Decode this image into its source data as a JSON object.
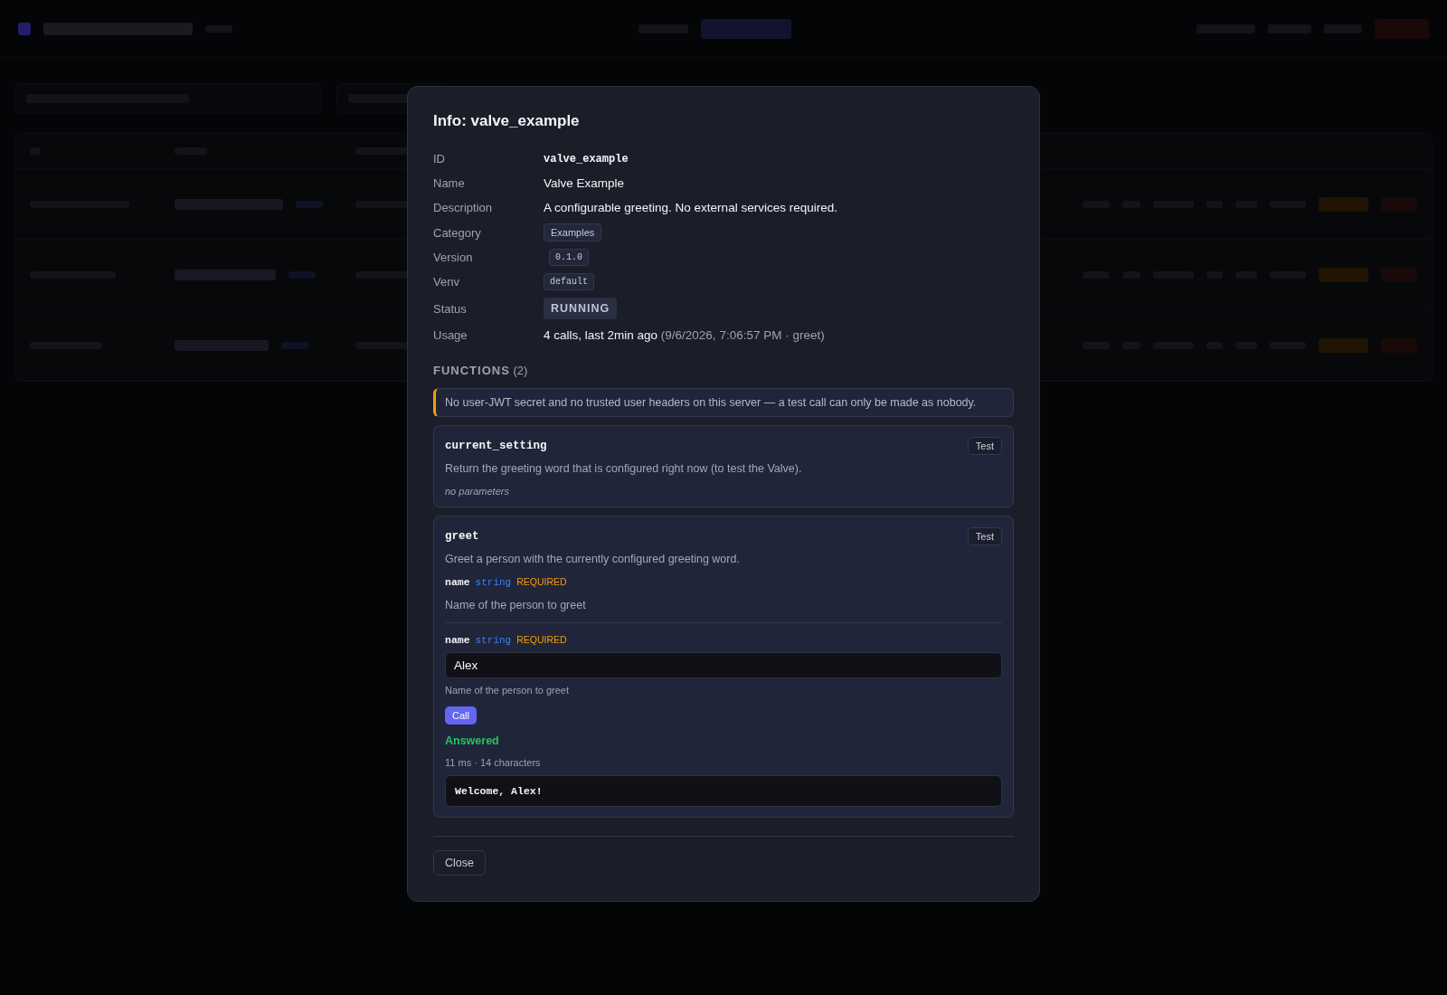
{
  "dialog": {
    "title": "Info: valve_example",
    "fields": [
      {
        "label": "ID",
        "value": "valve_example",
        "kind": "mono"
      },
      {
        "label": "Name",
        "value": "Valve Example",
        "kind": "text"
      },
      {
        "label": "Description",
        "value": "A configurable greeting. No external services required.",
        "kind": "text"
      },
      {
        "label": "Category",
        "value": "Examples",
        "kind": "tag"
      },
      {
        "label": "Version",
        "value": "0.1.0",
        "kind": "code"
      },
      {
        "label": "Venv",
        "value": "default",
        "kind": "code"
      },
      {
        "label": "Status",
        "value": "RUNNING",
        "kind": "status"
      },
      {
        "label": "Usage",
        "value": "4 calls, last 2min ago",
        "note": "(9/6/2026, 7:06:57 PM · greet)",
        "kind": "usage"
      }
    ],
    "functions_heading": "FUNCTIONS",
    "functions_count": "(2)",
    "warning": "No user-JWT secret and no trusted user headers on this server — a test call can only be made as nobody.",
    "functions": [
      {
        "name": "current_setting",
        "test": "Test",
        "description": "Return the greeting word that is configured right now (to test the Valve).",
        "no_params": "no parameters"
      },
      {
        "name": "greet",
        "test": "Test",
        "description": "Greet a person with the currently configured greeting word.",
        "params": [
          {
            "name": "name",
            "type": "string",
            "required": "REQUIRED",
            "description": "Name of the person to greet"
          }
        ],
        "test_form": {
          "param": {
            "name": "name",
            "type": "string",
            "required": "REQUIRED",
            "value": "Alex",
            "hint": "Name of the person to greet"
          },
          "call": "Call",
          "result_status": "Answered",
          "result_meta": "11 ms · 14 characters",
          "result": "Welcome, Alex!"
        }
      }
    ],
    "close": "Close"
  }
}
